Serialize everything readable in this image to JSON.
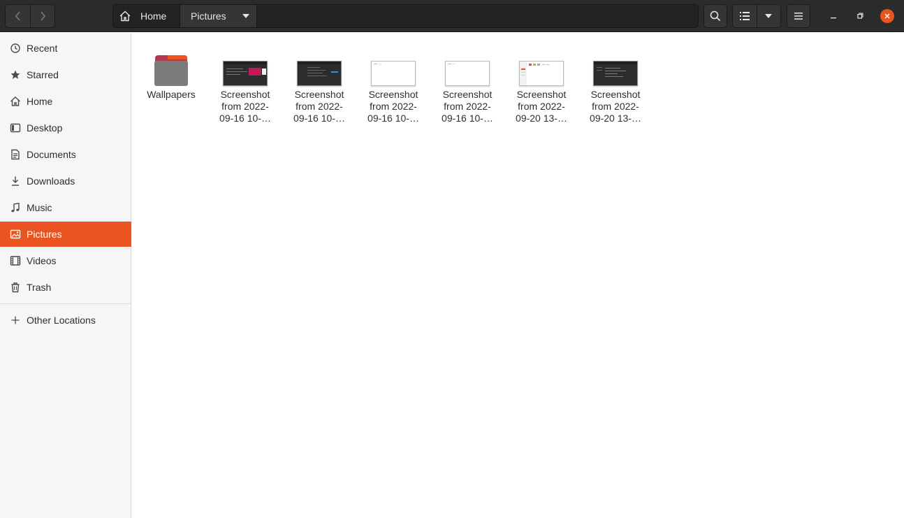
{
  "header": {
    "back_icon": "chevron-left-icon",
    "forward_icon": "chevron-right-icon",
    "path": {
      "home_label": "Home",
      "current_label": "Pictures"
    },
    "search_icon": "search-icon",
    "view_icon": "list-view-icon",
    "menu_icon": "hamburger-menu-icon"
  },
  "sidebar": {
    "items": [
      {
        "label": "Recent",
        "icon": "clock-icon"
      },
      {
        "label": "Starred",
        "icon": "star-icon"
      },
      {
        "label": "Home",
        "icon": "home-icon"
      },
      {
        "label": "Desktop",
        "icon": "desktop-icon"
      },
      {
        "label": "Documents",
        "icon": "document-icon"
      },
      {
        "label": "Downloads",
        "icon": "download-icon"
      },
      {
        "label": "Music",
        "icon": "music-icon"
      },
      {
        "label": "Pictures",
        "icon": "picture-icon",
        "active": true
      },
      {
        "label": "Videos",
        "icon": "film-icon"
      },
      {
        "label": "Trash",
        "icon": "trash-icon"
      }
    ],
    "other_locations": {
      "label": "Other Locations",
      "icon": "plus-icon"
    }
  },
  "files": [
    {
      "line1": "Wallpapers",
      "line2": "",
      "line3": "",
      "kind": "folder"
    },
    {
      "line1": "Screenshot",
      "line2": "from 2022-",
      "line3": "09-16 10-…",
      "kind": "dark-pink"
    },
    {
      "line1": "Screenshot",
      "line2": "from 2022-",
      "line3": "09-16 10-…",
      "kind": "dark-code"
    },
    {
      "line1": "Screenshot",
      "line2": "from 2022-",
      "line3": "09-16 10-…",
      "kind": "light"
    },
    {
      "line1": "Screenshot",
      "line2": "from 2022-",
      "line3": "09-16 10-…",
      "kind": "light"
    },
    {
      "line1": "Screenshot",
      "line2": "from 2022-",
      "line3": "09-20 13-…",
      "kind": "light-orange"
    },
    {
      "line1": "Screenshot",
      "line2": "from 2022-",
      "line3": "09-20 13-…",
      "kind": "dark-code"
    }
  ],
  "colors": {
    "accent": "#e95420",
    "headerbar": "#2b2b2b",
    "sidebar_bg": "#f6f6f6"
  }
}
